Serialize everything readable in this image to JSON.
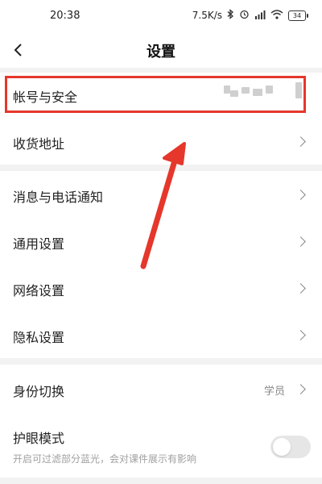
{
  "status_bar": {
    "time": "20:38",
    "network_speed": "7.5K/s",
    "battery": "34",
    "icons": [
      "bluetooth-icon",
      "alarm-icon",
      "signal-icon",
      "wifi-icon",
      "battery-icon"
    ]
  },
  "header": {
    "title": "设置",
    "back_icon": "chevron-left-icon"
  },
  "settings": {
    "account": "帐号与安全",
    "address": "收货地址",
    "notifications": "消息与电话通知",
    "general": "通用设置",
    "network": "网络设置",
    "privacy": "隐私设置",
    "identity": "身份切换",
    "identity_value": "学员",
    "eye_mode": "护眼模式",
    "eye_mode_desc": "开启可过滤部分蓝光，会对课件展示有影响",
    "eye_mode_enabled": false
  },
  "annotation": {
    "color": "#e5372b",
    "highlight": "account-row",
    "arrow_pointing_to": "account-row"
  },
  "colors": {
    "background": "#f2f2f2",
    "row_background": "#ffffff",
    "chevron": "#8a8a8a",
    "subtext": "#a0a0a0"
  }
}
